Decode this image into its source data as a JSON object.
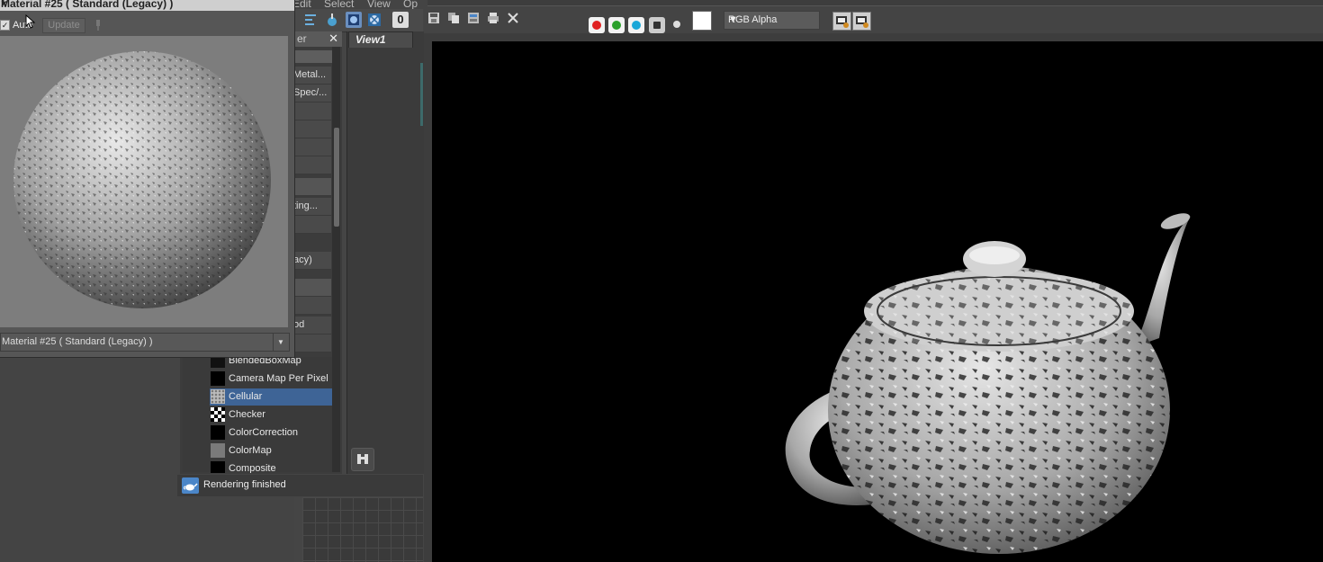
{
  "menu": {
    "items": [
      "Edit",
      "Select",
      "View",
      "Op"
    ]
  },
  "material_editor": {
    "title": "Material #25  ( Standard (Legacy) )",
    "auto_label": "Auto",
    "update_label": "Update",
    "material_name": "Material #25  ( Standard (Legacy) )"
  },
  "browser": {
    "header": "er",
    "rows": [
      "Metal...",
      "Spec/...",
      "",
      "",
      "",
      "",
      "",
      "ting...",
      "",
      "acy)",
      "",
      "",
      "od",
      ""
    ],
    "maps": [
      {
        "label": "BlendedBoxMap",
        "swatch": "#111111"
      },
      {
        "label": "Camera Map Per Pixel",
        "swatch": "#000000"
      },
      {
        "label": "Cellular",
        "swatch": "cellular",
        "selected": true
      },
      {
        "label": "Checker",
        "swatch": "checker"
      },
      {
        "label": "ColorCorrection",
        "swatch": "#000000"
      },
      {
        "label": "ColorMap",
        "swatch": "#7a7a7a"
      },
      {
        "label": "Composite",
        "swatch": "#000000"
      }
    ]
  },
  "viewport": {
    "tab_label": "View1"
  },
  "status": {
    "text": "Rendering finished"
  },
  "render_window": {
    "channel_display": "RGB Alpha",
    "channel_colors": {
      "red": "#e02020",
      "green": "#2aa02a",
      "blue": "#1aa7d8"
    }
  }
}
